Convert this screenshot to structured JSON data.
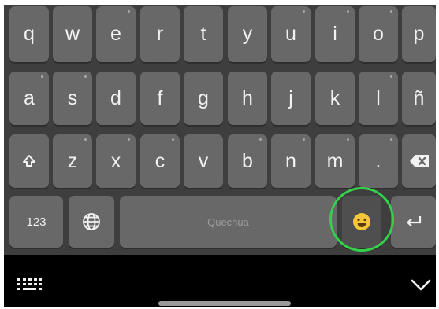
{
  "keyboard": {
    "row1": [
      "q",
      "w",
      "e",
      "r",
      "t",
      "y",
      "u",
      "i",
      "o",
      "p"
    ],
    "row2": [
      "a",
      "s",
      "d",
      "f",
      "g",
      "h",
      "j",
      "k",
      "l",
      "ñ"
    ],
    "row3": [
      "z",
      "x",
      "c",
      "v",
      "b",
      "n",
      "m",
      "."
    ],
    "numbers_label": "123",
    "space_label": "Quechua"
  },
  "icons": {
    "shift": "shift-icon",
    "backspace": "backspace-icon",
    "language": "globe-icon",
    "emoji": "emoji-icon",
    "enter": "enter-icon",
    "keyboard_switch": "keyboard-icon",
    "collapse": "chevron-down-icon"
  },
  "colors": {
    "keyboard_bg": "#3e3e3e",
    "key_bg": "#686868",
    "emoji_key_bg": "#4f4f4f",
    "highlight_ring": "#33d24a",
    "nav_bar_bg": "#000000"
  }
}
